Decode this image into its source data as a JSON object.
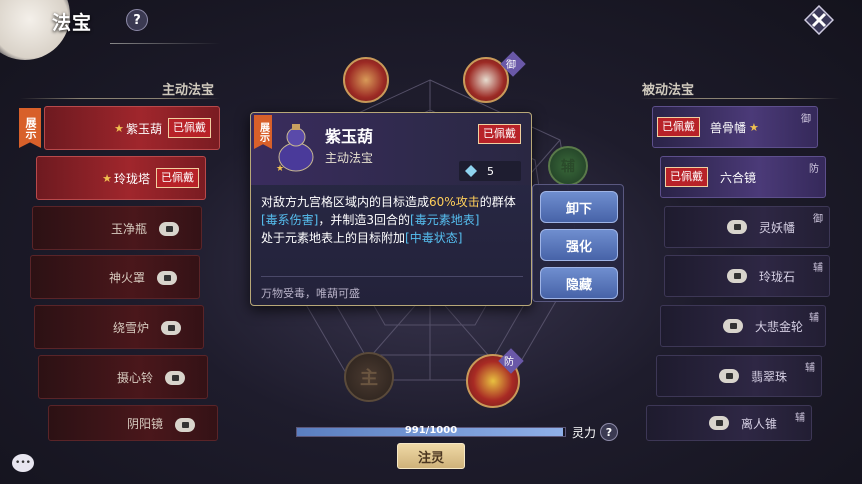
{
  "header": {
    "title": "法宝",
    "help": "?"
  },
  "sections": {
    "active": "主动法宝",
    "passive": "被动法宝"
  },
  "left_badge": "展示",
  "left_items": [
    {
      "name": "紫玉葫",
      "worn": "已佩戴",
      "star": "★"
    },
    {
      "name": "玲珑塔",
      "worn": "已佩戴",
      "star": "★"
    },
    {
      "name": "玉净瓶"
    },
    {
      "name": "神火罩"
    },
    {
      "name": "绕雪炉"
    },
    {
      "name": "摄心铃"
    },
    {
      "name": "阴阳镜"
    }
  ],
  "right_items": [
    {
      "name": "兽骨幡",
      "worn": "已佩戴",
      "star": "★",
      "tag": "御"
    },
    {
      "name": "六合镜",
      "worn": "已佩戴",
      "tag": "防"
    },
    {
      "name": "灵妖幡",
      "tag": "御"
    },
    {
      "name": "玲珑石",
      "tag": "辅"
    },
    {
      "name": "大悲金轮",
      "tag": "辅"
    },
    {
      "name": "翡翠珠",
      "tag": "辅"
    },
    {
      "name": "离人锥",
      "tag": "辅"
    }
  ],
  "center": {
    "slot_tag_top": "御",
    "slot_tag_bottom": "防",
    "center_char": "主",
    "side_char": "辅"
  },
  "detail": {
    "badge": "展示",
    "name": "紫玉葫",
    "type": "主动法宝",
    "worn": "已佩戴",
    "cost": "5",
    "desc_1": "对敌方九宫格区域内的目标造成",
    "desc_2": "60%攻击",
    "desc_3": "的群体",
    "desc_4": "[毒系伤害]",
    "desc_5": "，并制造3回合的",
    "desc_6": "[毒元素地表]",
    "desc_7": "处于元素地表上的目标附加",
    "desc_8": "[中毒状态]",
    "flavor": "万物受毒，唯葫可盛"
  },
  "actions": {
    "unequip": "卸下",
    "enhance": "强化",
    "hide": "隐藏"
  },
  "spirit": {
    "value": 991,
    "max": 1000,
    "text": "991/1000",
    "label": "灵力",
    "help": "?"
  },
  "inject_label": "注灵",
  "colors": {
    "accent_red": "#b82228",
    "accent_blue": "#4763a8",
    "gold": "#cfb27a"
  }
}
